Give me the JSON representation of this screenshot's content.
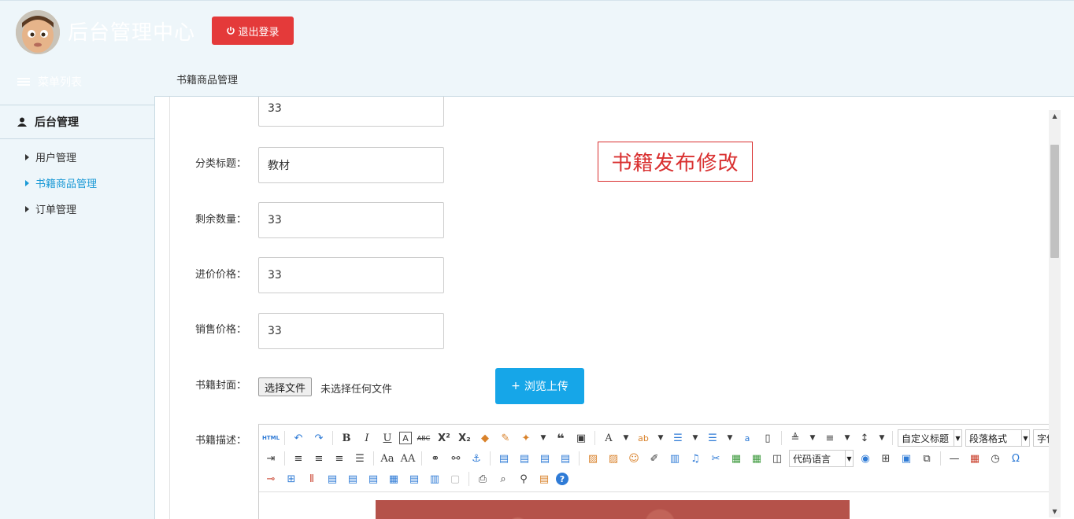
{
  "header": {
    "site_title": "后台管理中心",
    "logout_label": "退出登录"
  },
  "sidebar": {
    "menu_list_label": "菜单列表",
    "section_label": "后台管理",
    "items": [
      {
        "label": "用户管理",
        "active": false
      },
      {
        "label": "书籍商品管理",
        "active": true
      },
      {
        "label": "订单管理",
        "active": false
      }
    ]
  },
  "breadcrumb": "书籍商品管理",
  "form": {
    "title": "书籍发布修改",
    "partial_field_value": "33",
    "category_label": "分类标题：",
    "category_value": "教材",
    "stock_label": "剩余数量：",
    "stock_value": "33",
    "purchase_price_label": "进价价格：",
    "purchase_price_value": "33",
    "sale_price_label": "销售价格：",
    "sale_price_value": "33",
    "cover_label": "书籍封面：",
    "choose_file_label": "选择文件",
    "file_status": "未选择任何文件",
    "upload_label": "浏览上传",
    "description_label": "书籍描述："
  },
  "editor": {
    "html_label": "HTML",
    "custom_heading": "自定义标题",
    "paragraph_format": "段落格式",
    "font_family": "字体",
    "code_language": "代码语言"
  },
  "colors": {
    "logout": "#e43a3a",
    "active_nav": "#1c9ad6",
    "upload": "#16a6e8",
    "title_border": "#d93030"
  }
}
